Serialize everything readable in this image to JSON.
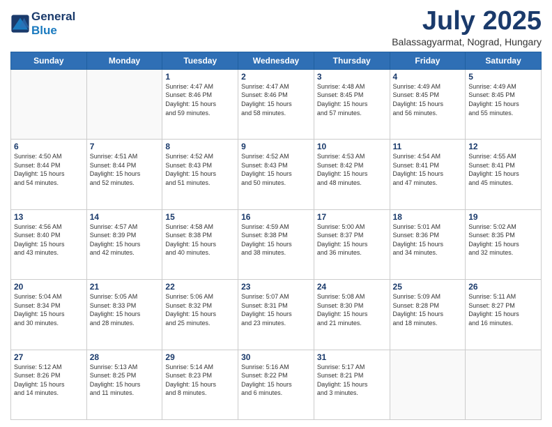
{
  "logo": {
    "line1": "General",
    "line2": "Blue"
  },
  "title": "July 2025",
  "subtitle": "Balassagyarmat, Nograd, Hungary",
  "days_of_week": [
    "Sunday",
    "Monday",
    "Tuesday",
    "Wednesday",
    "Thursday",
    "Friday",
    "Saturday"
  ],
  "weeks": [
    [
      {
        "day": "",
        "info": ""
      },
      {
        "day": "",
        "info": ""
      },
      {
        "day": "1",
        "info": "Sunrise: 4:47 AM\nSunset: 8:46 PM\nDaylight: 15 hours\nand 59 minutes."
      },
      {
        "day": "2",
        "info": "Sunrise: 4:47 AM\nSunset: 8:46 PM\nDaylight: 15 hours\nand 58 minutes."
      },
      {
        "day": "3",
        "info": "Sunrise: 4:48 AM\nSunset: 8:45 PM\nDaylight: 15 hours\nand 57 minutes."
      },
      {
        "day": "4",
        "info": "Sunrise: 4:49 AM\nSunset: 8:45 PM\nDaylight: 15 hours\nand 56 minutes."
      },
      {
        "day": "5",
        "info": "Sunrise: 4:49 AM\nSunset: 8:45 PM\nDaylight: 15 hours\nand 55 minutes."
      }
    ],
    [
      {
        "day": "6",
        "info": "Sunrise: 4:50 AM\nSunset: 8:44 PM\nDaylight: 15 hours\nand 54 minutes."
      },
      {
        "day": "7",
        "info": "Sunrise: 4:51 AM\nSunset: 8:44 PM\nDaylight: 15 hours\nand 52 minutes."
      },
      {
        "day": "8",
        "info": "Sunrise: 4:52 AM\nSunset: 8:43 PM\nDaylight: 15 hours\nand 51 minutes."
      },
      {
        "day": "9",
        "info": "Sunrise: 4:52 AM\nSunset: 8:43 PM\nDaylight: 15 hours\nand 50 minutes."
      },
      {
        "day": "10",
        "info": "Sunrise: 4:53 AM\nSunset: 8:42 PM\nDaylight: 15 hours\nand 48 minutes."
      },
      {
        "day": "11",
        "info": "Sunrise: 4:54 AM\nSunset: 8:41 PM\nDaylight: 15 hours\nand 47 minutes."
      },
      {
        "day": "12",
        "info": "Sunrise: 4:55 AM\nSunset: 8:41 PM\nDaylight: 15 hours\nand 45 minutes."
      }
    ],
    [
      {
        "day": "13",
        "info": "Sunrise: 4:56 AM\nSunset: 8:40 PM\nDaylight: 15 hours\nand 43 minutes."
      },
      {
        "day": "14",
        "info": "Sunrise: 4:57 AM\nSunset: 8:39 PM\nDaylight: 15 hours\nand 42 minutes."
      },
      {
        "day": "15",
        "info": "Sunrise: 4:58 AM\nSunset: 8:38 PM\nDaylight: 15 hours\nand 40 minutes."
      },
      {
        "day": "16",
        "info": "Sunrise: 4:59 AM\nSunset: 8:38 PM\nDaylight: 15 hours\nand 38 minutes."
      },
      {
        "day": "17",
        "info": "Sunrise: 5:00 AM\nSunset: 8:37 PM\nDaylight: 15 hours\nand 36 minutes."
      },
      {
        "day": "18",
        "info": "Sunrise: 5:01 AM\nSunset: 8:36 PM\nDaylight: 15 hours\nand 34 minutes."
      },
      {
        "day": "19",
        "info": "Sunrise: 5:02 AM\nSunset: 8:35 PM\nDaylight: 15 hours\nand 32 minutes."
      }
    ],
    [
      {
        "day": "20",
        "info": "Sunrise: 5:04 AM\nSunset: 8:34 PM\nDaylight: 15 hours\nand 30 minutes."
      },
      {
        "day": "21",
        "info": "Sunrise: 5:05 AM\nSunset: 8:33 PM\nDaylight: 15 hours\nand 28 minutes."
      },
      {
        "day": "22",
        "info": "Sunrise: 5:06 AM\nSunset: 8:32 PM\nDaylight: 15 hours\nand 25 minutes."
      },
      {
        "day": "23",
        "info": "Sunrise: 5:07 AM\nSunset: 8:31 PM\nDaylight: 15 hours\nand 23 minutes."
      },
      {
        "day": "24",
        "info": "Sunrise: 5:08 AM\nSunset: 8:30 PM\nDaylight: 15 hours\nand 21 minutes."
      },
      {
        "day": "25",
        "info": "Sunrise: 5:09 AM\nSunset: 8:28 PM\nDaylight: 15 hours\nand 18 minutes."
      },
      {
        "day": "26",
        "info": "Sunrise: 5:11 AM\nSunset: 8:27 PM\nDaylight: 15 hours\nand 16 minutes."
      }
    ],
    [
      {
        "day": "27",
        "info": "Sunrise: 5:12 AM\nSunset: 8:26 PM\nDaylight: 15 hours\nand 14 minutes."
      },
      {
        "day": "28",
        "info": "Sunrise: 5:13 AM\nSunset: 8:25 PM\nDaylight: 15 hours\nand 11 minutes."
      },
      {
        "day": "29",
        "info": "Sunrise: 5:14 AM\nSunset: 8:23 PM\nDaylight: 15 hours\nand 8 minutes."
      },
      {
        "day": "30",
        "info": "Sunrise: 5:16 AM\nSunset: 8:22 PM\nDaylight: 15 hours\nand 6 minutes."
      },
      {
        "day": "31",
        "info": "Sunrise: 5:17 AM\nSunset: 8:21 PM\nDaylight: 15 hours\nand 3 minutes."
      },
      {
        "day": "",
        "info": ""
      },
      {
        "day": "",
        "info": ""
      }
    ]
  ]
}
